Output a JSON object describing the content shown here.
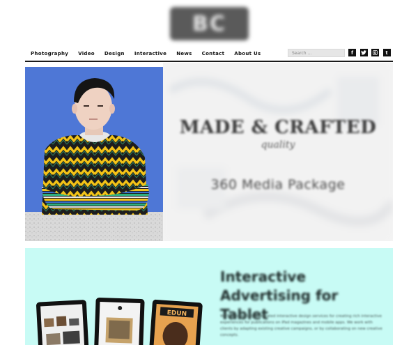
{
  "header": {
    "logo_text": "BC"
  },
  "nav": {
    "items": [
      {
        "label": "Photography"
      },
      {
        "label": "Video"
      },
      {
        "label": "Design"
      },
      {
        "label": "Interactive"
      },
      {
        "label": "News"
      },
      {
        "label": "Contact"
      },
      {
        "label": "About Us"
      }
    ],
    "search_placeholder": "Search ...",
    "social": [
      {
        "icon": "facebook-icon",
        "glyph": "f"
      },
      {
        "icon": "twitter-icon",
        "glyph": "t"
      },
      {
        "icon": "instagram-icon",
        "glyph": "◙"
      },
      {
        "icon": "tumblr-icon",
        "glyph": "t"
      }
    ]
  },
  "hero": {
    "title": "MADE & CRAFTED",
    "script": "quality",
    "subtitle": "360 Media Package",
    "photo_bg": "#4e77d6"
  },
  "promo": {
    "title": "Interactive Advertising for Tablet",
    "body": "We'll provide fully integrated interactive design services for creating rich interactive experiences for publications on iPad magazines and mobile apps. We work with clients by adapting existing creative campaigns, or by collaborating on new creative concepts.",
    "bg": "#c8fbf5"
  },
  "colors": {
    "nav_text": "#111111",
    "divider": "#1a1a1a",
    "search_bg": "#e6e6e6",
    "social_bg": "#111111"
  }
}
